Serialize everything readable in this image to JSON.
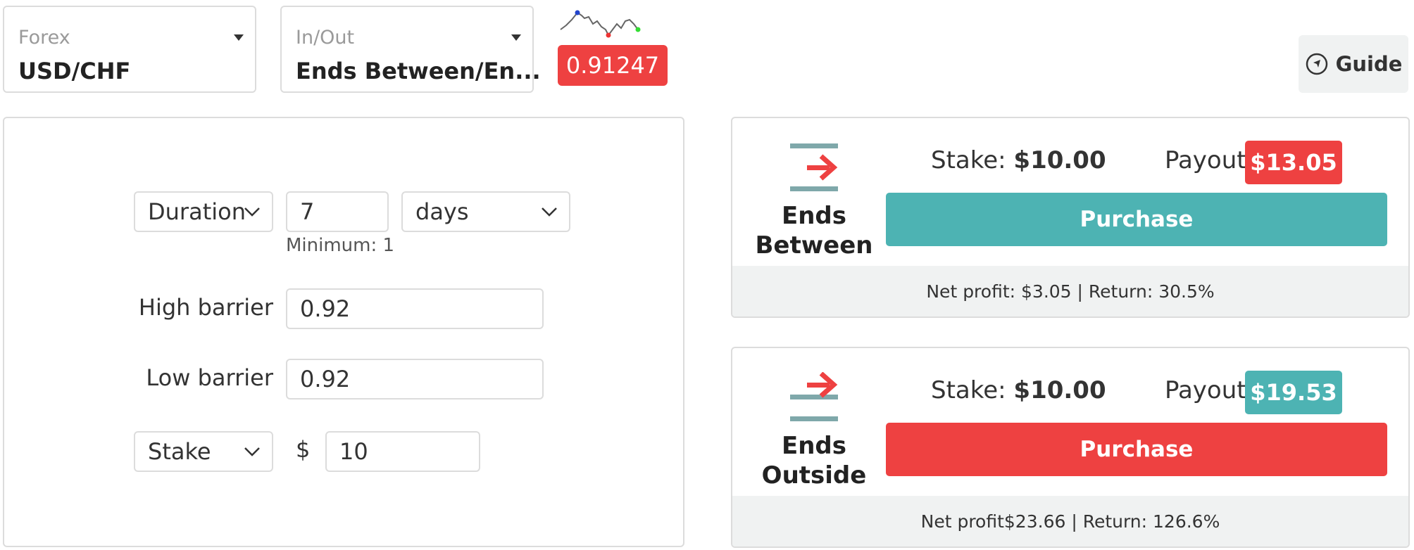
{
  "market": {
    "label": "Forex",
    "value": "USD/CHF"
  },
  "trade_type": {
    "label": "In/Out",
    "value": "Ends Between/En..."
  },
  "spot_price": "0.91247",
  "guide_label": "Guide",
  "form": {
    "duration_select": "Duration",
    "duration_value": "7",
    "duration_unit": "days",
    "minimum_text": "Minimum: 1",
    "high_barrier_label": "High barrier",
    "high_barrier_value": "0.92",
    "low_barrier_label": "Low barrier",
    "low_barrier_value": "0.92",
    "stake_select": "Stake",
    "currency_symbol": "$",
    "stake_value": "10"
  },
  "contracts": [
    {
      "title_line1": "Ends",
      "title_line2": "Between",
      "stake_label": "Stake:",
      "stake_value": "$10.00",
      "payout_label": "Payout:",
      "payout_value": "$13.05",
      "payout_color": "#ee4141",
      "purchase_label": "Purchase",
      "purchase_color": "#4db3b3",
      "footer": "Net profit: $3.05 | Return: 30.5%"
    },
    {
      "title_line1": "Ends",
      "title_line2": "Outside",
      "stake_label": "Stake:",
      "stake_value": "$10.00",
      "payout_label": "Payout:",
      "payout_value": "$19.53",
      "payout_color": "#4db3b3",
      "purchase_label": "Purchase",
      "purchase_color": "#ee4141",
      "footer": "Net profit$23.66 | Return: 126.6%"
    }
  ],
  "colors": {
    "accent_red": "#ee4141",
    "accent_teal": "#4db3b3",
    "icon_gray": "#7fa8aa"
  }
}
